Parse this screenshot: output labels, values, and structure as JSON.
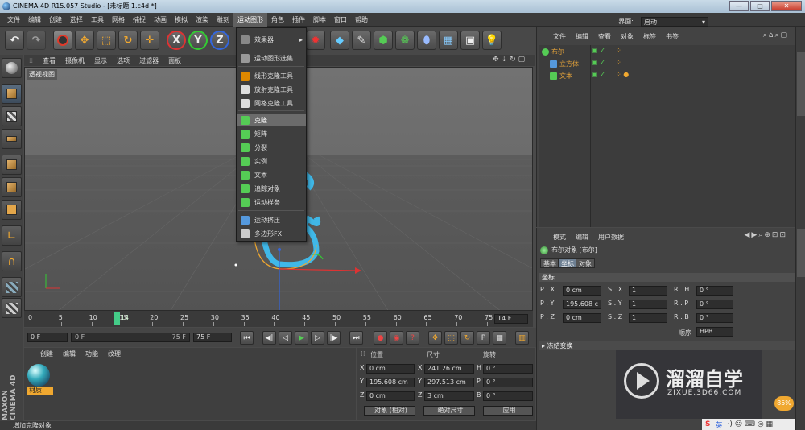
{
  "title": "CINEMA 4D R15.057 Studio - [未标题 1.c4d *]",
  "window_buttons": [
    "—",
    "□",
    "✕"
  ],
  "menubar": [
    "文件",
    "编辑",
    "创建",
    "选择",
    "工具",
    "网格",
    "捕捉",
    "动画",
    "模拟",
    "渲染",
    "雕刻",
    "运动图形",
    "角色",
    "插件",
    "脚本",
    "窗口",
    "帮助"
  ],
  "menubar_active": "运动图形",
  "layout_label": "界面:",
  "layout_value": "启动",
  "toolbar": [
    "undo-icon",
    "redo-icon",
    "live-select-icon",
    "move-icon",
    "scale-icon",
    "rotate-icon",
    "world-icon",
    "x-axis-icon",
    "y-axis-icon",
    "z-axis-icon",
    "coord-icon",
    "clapper-icon",
    "cube-icon",
    "pen-icon",
    "nurbs-icon",
    "array-icon",
    "deformer-icon",
    "scene-icon",
    "camera-icon",
    "light-icon"
  ],
  "axis_labels": [
    "X",
    "Y",
    "Z"
  ],
  "viewport_menu": [
    "查看",
    "摄像机",
    "显示",
    "选项",
    "过滤器",
    "面板"
  ],
  "viewport_label": "透视视图",
  "mograph_menu": {
    "items": [
      {
        "label": "效果器",
        "arrow": "▸"
      },
      {
        "label": "运动图形选集"
      },
      {
        "label": "线形克隆工具"
      },
      {
        "label": "放射克隆工具"
      },
      {
        "label": "网格克隆工具"
      },
      {
        "label": "克隆",
        "highlight": true
      },
      {
        "label": "矩阵"
      },
      {
        "label": "分裂"
      },
      {
        "label": "实例"
      },
      {
        "label": "文本"
      },
      {
        "label": "追踪对象"
      },
      {
        "label": "运动样条"
      },
      {
        "label": "运动挤压"
      },
      {
        "label": "多边形FX"
      }
    ]
  },
  "timeline": {
    "ticks": [
      "0",
      "5",
      "10",
      "15",
      "20",
      "25",
      "30",
      "35",
      "40",
      "45",
      "50",
      "55",
      "60",
      "65",
      "70",
      "75"
    ],
    "current": "14",
    "end_field": "14 F"
  },
  "playbar": {
    "start": "0 F",
    "range_start": "0 F",
    "range_end": "75 F",
    "end": "75 F"
  },
  "material_menu": [
    "创建",
    "编辑",
    "功能",
    "纹理"
  ],
  "material_name": "材质",
  "maxon_logo": "MAXON CINEMA 4D",
  "coords": {
    "headers": [
      "位置",
      "尺寸",
      "旋转"
    ],
    "rows": [
      {
        "axis": "X",
        "pos": "0 cm",
        "size": "241.26 cm",
        "rot_label": "H",
        "rot": "0 °"
      },
      {
        "axis": "Y",
        "pos": "195.608 cm",
        "size": "297.513 cm",
        "rot_label": "P",
        "rot": "0 °"
      },
      {
        "axis": "Z",
        "pos": "0 cm",
        "size": "3 cm",
        "rot_label": "B",
        "rot": "0 °"
      }
    ],
    "mode1": "对象 (相对)",
    "mode2": "绝对尺寸",
    "apply": "应用"
  },
  "status": "增加克隆对象",
  "object_manager": {
    "menu": [
      "文件",
      "编辑",
      "查看",
      "对象",
      "标签",
      "书签"
    ],
    "objects": [
      {
        "name": "布尔",
        "color": "#e5a33a"
      },
      {
        "name": "立方体",
        "color": "#e5a33a"
      },
      {
        "name": "文本",
        "color": "#e5a33a"
      }
    ]
  },
  "attr_manager": {
    "menu": [
      "模式",
      "编辑",
      "用户数据"
    ],
    "object_title": "布尔对象 [布尔]",
    "tabs": [
      "基本",
      "坐标",
      "对象"
    ],
    "active_tab": "坐标",
    "section": "坐标",
    "rows": [
      {
        "p": "P . X",
        "pv": "0 cm",
        "s": "S . X",
        "sv": "1",
        "r": "R . H",
        "rv": "0 °"
      },
      {
        "p": "P . Y",
        "pv": "195.608 c",
        "s": "S . Y",
        "sv": "1",
        "r": "R . P",
        "rv": "0 °"
      },
      {
        "p": "P . Z",
        "pv": "0 cm",
        "s": "S . Z",
        "sv": "1",
        "r": "R . B",
        "rv": "0 °"
      }
    ],
    "order_label": "顺序",
    "order_value": "HPB",
    "freeze": "冻结变换"
  },
  "watermark": {
    "title": "溜溜自学",
    "url": "ZIXUE.3D66.COM"
  },
  "badge": "85%",
  "ime": "英",
  "colors": {
    "accent": "#40b8e8",
    "highlight": "#6b6b6b",
    "object_orange": "#e5a33a"
  }
}
